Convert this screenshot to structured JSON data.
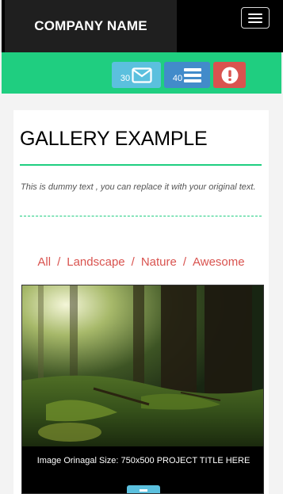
{
  "navbar": {
    "brand": "COMPANY NAME",
    "toggle_icon": "hamburger-menu-icon"
  },
  "actions": {
    "mail_count": "30",
    "mail_icon": "envelope-icon",
    "list_count": "40",
    "list_icon": "list-icon",
    "alert_icon": "exclamation-circle-icon"
  },
  "gallery": {
    "title": "GALLERY EXAMPLE",
    "intro": "This is dummy text , you can replace it with your original text.",
    "filters": [
      "All",
      "Landscape",
      "Nature",
      "Awesome"
    ],
    "separator": "/",
    "items": [
      {
        "caption": "Image Orinagal Size: 750x500 PROJECT TITLE HERE"
      }
    ]
  },
  "colors": {
    "accent_green": "#1fce80",
    "info": "#5bc0de",
    "primary": "#428bca",
    "danger": "#d9534f"
  }
}
